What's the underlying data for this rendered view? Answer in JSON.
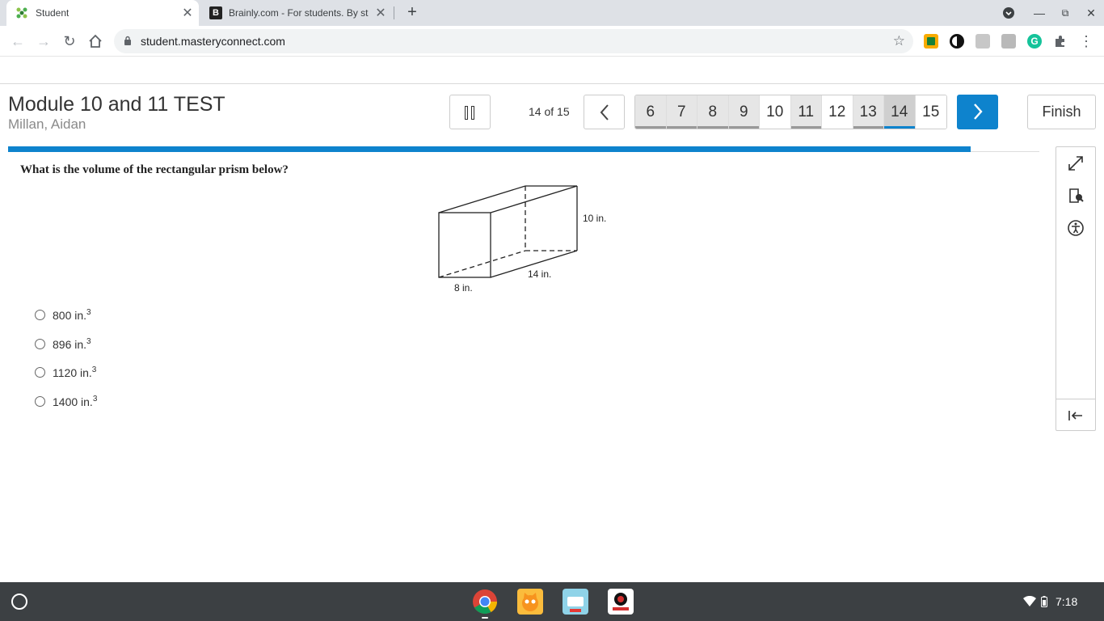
{
  "browser": {
    "tabs": [
      {
        "title": "Student",
        "active": true
      },
      {
        "title": "Brainly.com - For students. By st",
        "active": false
      }
    ],
    "url": "student.masteryconnect.com"
  },
  "assessment": {
    "title": "Module 10 and 11 TEST",
    "student": "Millan, Aidan",
    "progress_text": "14 of 15",
    "current_question": 14,
    "total_questions": 15,
    "question_numbers": [
      "6",
      "7",
      "8",
      "9",
      "10",
      "11",
      "12",
      "13",
      "14",
      "15"
    ],
    "answered": [
      "6",
      "7",
      "8",
      "9",
      "11",
      "13"
    ],
    "finish_label": "Finish",
    "progress_fraction": 0.933
  },
  "question": {
    "text": "What is the volume of the rectangular prism below?",
    "figure_labels": {
      "height": "10 in.",
      "length": "14 in.",
      "width": "8 in."
    },
    "options": [
      {
        "value": "800 in.",
        "exp": "3"
      },
      {
        "value": "896 in.",
        "exp": "3"
      },
      {
        "value": "1120 in.",
        "exp": "3"
      },
      {
        "value": "1400 in.",
        "exp": "3"
      }
    ]
  },
  "shelf": {
    "time": "7:18"
  },
  "colors": {
    "accent": "#0e83cd",
    "tabstrip": "#dee1e6",
    "shelf": "#3c4043"
  }
}
